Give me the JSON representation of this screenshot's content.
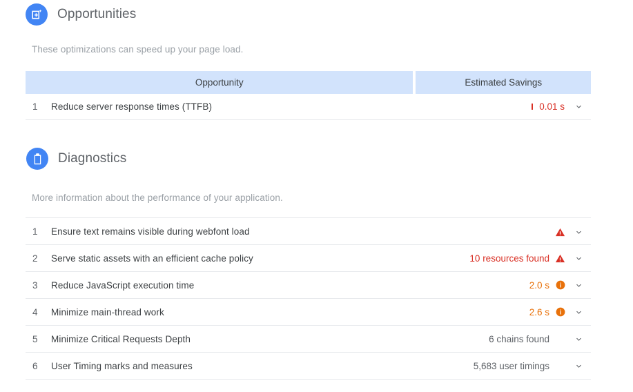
{
  "sections": [
    {
      "id": "opportunities",
      "title": "Opportunities",
      "icon": "opportunity-sparkle-icon",
      "description": "These optimizations can speed up your page load.",
      "table": {
        "columns": [
          "Opportunity",
          "Estimated Savings"
        ],
        "rows": [
          {
            "num": "1",
            "name": "Reduce server response times (TTFB)",
            "value": "0.01 s",
            "value_color": "#d93025",
            "sparkbar": true,
            "badge": "none",
            "chevron": "chevron-down-icon"
          }
        ]
      }
    },
    {
      "id": "diagnostics",
      "title": "Diagnostics",
      "icon": "clipboard-icon",
      "description": "More information about the performance of your application.",
      "table": {
        "columns": [],
        "rows": [
          {
            "num": "1",
            "name": "Ensure text remains visible during webfont load",
            "value": "",
            "value_color": "#d93025",
            "badge": "warning",
            "chevron": "chevron-down-icon"
          },
          {
            "num": "2",
            "name": "Serve static assets with an efficient cache policy",
            "value": "10 resources found",
            "value_color": "#d93025",
            "badge": "warning",
            "chevron": "chevron-down-icon"
          },
          {
            "num": "3",
            "name": "Reduce JavaScript execution time",
            "value": "2.0 s",
            "value_color": "#e8710a",
            "badge": "info",
            "chevron": "chevron-down-icon"
          },
          {
            "num": "4",
            "name": "Minimize main-thread work",
            "value": "2.6 s",
            "value_color": "#e8710a",
            "badge": "info",
            "chevron": "chevron-down-icon"
          },
          {
            "num": "5",
            "name": "Minimize Critical Requests Depth",
            "value": "6 chains found",
            "value_color": "#5f6368",
            "badge": "none",
            "chevron": "chevron-down-icon"
          },
          {
            "num": "6",
            "name": "User Timing marks and measures",
            "value": "5,683 user timings",
            "value_color": "#5f6368",
            "badge": "none",
            "chevron": "chevron-down-icon"
          }
        ]
      }
    }
  ],
  "colors": {
    "accent_blue": "#4285f4",
    "header_bg": "#d2e3fc",
    "error_red": "#d93025",
    "warn_orange": "#e8710a",
    "text_gray": "#5f6368",
    "text_light": "#9aa0a6",
    "divider": "#e8eaed"
  }
}
